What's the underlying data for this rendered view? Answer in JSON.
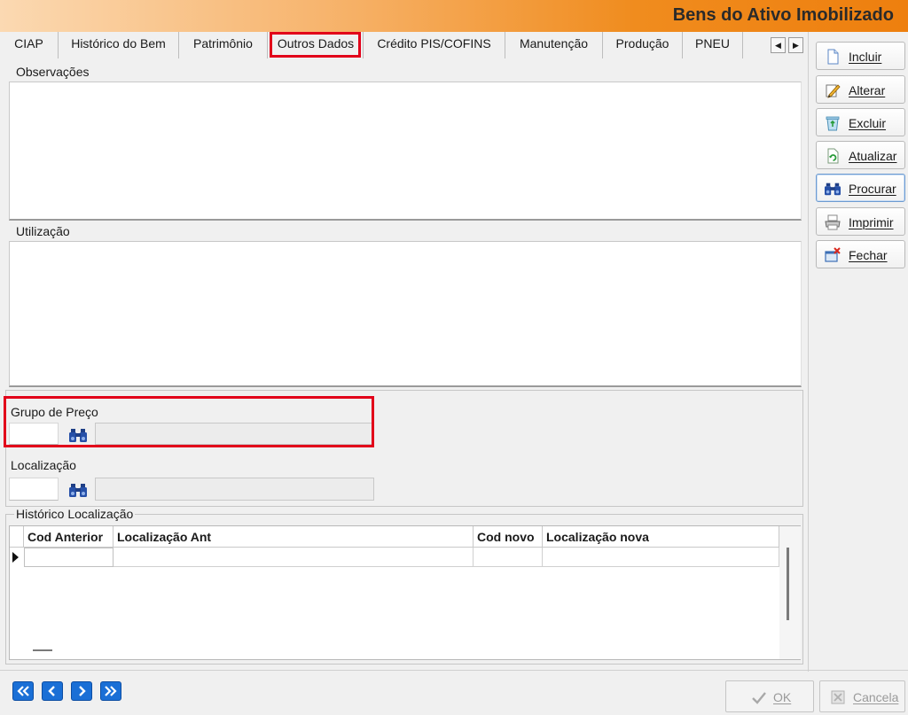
{
  "window": {
    "title": "Bens do Ativo Imobilizado"
  },
  "tabs": [
    {
      "label": "CIAP"
    },
    {
      "label": "Histórico do Bem"
    },
    {
      "label": "Patrimônio"
    },
    {
      "label": "Outros Dados",
      "active": true
    },
    {
      "label": "Crédito PIS/COFINS"
    },
    {
      "label": "Manutenção"
    },
    {
      "label": "Produção"
    },
    {
      "label": "PNEU"
    }
  ],
  "sections": {
    "observacoes": {
      "label": "Observações",
      "value": ""
    },
    "utilizacao": {
      "label": "Utilização",
      "value": ""
    },
    "grupo_preco": {
      "label": "Grupo de Preço",
      "code": "",
      "description": ""
    },
    "localizacao": {
      "label": "Localização",
      "code": "",
      "description": ""
    },
    "historico": {
      "label": "Histórico Localização",
      "columns": [
        "Cod Anterior",
        "Localização Ant",
        "Cod novo",
        "Localização nova"
      ],
      "rows": [
        [
          "",
          "",
          "",
          ""
        ]
      ]
    }
  },
  "side_buttons": [
    {
      "label": "Incluir",
      "icon": "new-document-icon"
    },
    {
      "label": "Alterar",
      "icon": "edit-pencil-icon"
    },
    {
      "label": "Excluir",
      "icon": "recycle-bin-icon"
    },
    {
      "label": "Atualizar",
      "icon": "refresh-icon"
    },
    {
      "label": "Procurar",
      "icon": "binoculars-icon",
      "focused": true
    },
    {
      "label": "Imprimir",
      "icon": "printer-icon"
    },
    {
      "label": "Fechar",
      "icon": "close-window-icon"
    }
  ],
  "footer": {
    "ok_label": "OK",
    "cancel_label": "Cancela"
  },
  "colors": {
    "accent_orange": "#ee7f0e",
    "highlight_red": "#e2001a",
    "nav_blue": "#1a6fd6"
  }
}
